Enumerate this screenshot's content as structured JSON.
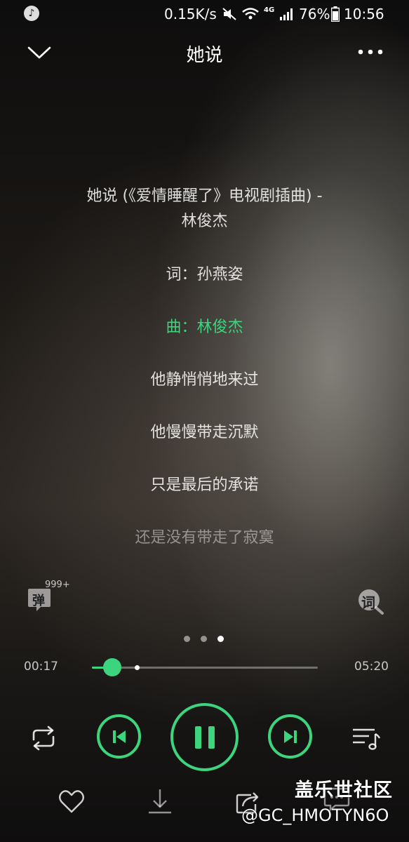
{
  "status_bar": {
    "speed": "0.15K/s",
    "network": "4G",
    "battery": "76%",
    "time": "10:56",
    "icons": [
      "app-notification-icon",
      "mute-icon",
      "wifi-icon",
      "signal-icon",
      "battery-icon"
    ]
  },
  "header": {
    "title": "她说",
    "back_icon": "chevron-down-icon",
    "more_icon": "more-dots-icon"
  },
  "lyrics": {
    "title_line_1": "她说 (《爱情睡醒了》电视剧插曲) -",
    "title_line_2": "林俊杰",
    "lines": [
      "词：孙燕姿",
      "曲：林俊杰",
      "他静悄悄地来过",
      "他慢慢带走沉默",
      "只是最后的承诺",
      "还是没有带走了寂寞"
    ],
    "active_index": 1
  },
  "danmu": {
    "label": "弹",
    "count": "999+"
  },
  "lyric_search": {
    "label": "词"
  },
  "pager": {
    "count": 3,
    "active": 2
  },
  "player": {
    "current_time": "00:17",
    "total_time": "05:20",
    "progress": 0.09,
    "buffered": 0.19,
    "state": "playing"
  },
  "colors": {
    "accent": "#3dd47e"
  },
  "watermark": {
    "line1": "盖乐世社区",
    "line2": "@GC_HMOTYN6O"
  }
}
